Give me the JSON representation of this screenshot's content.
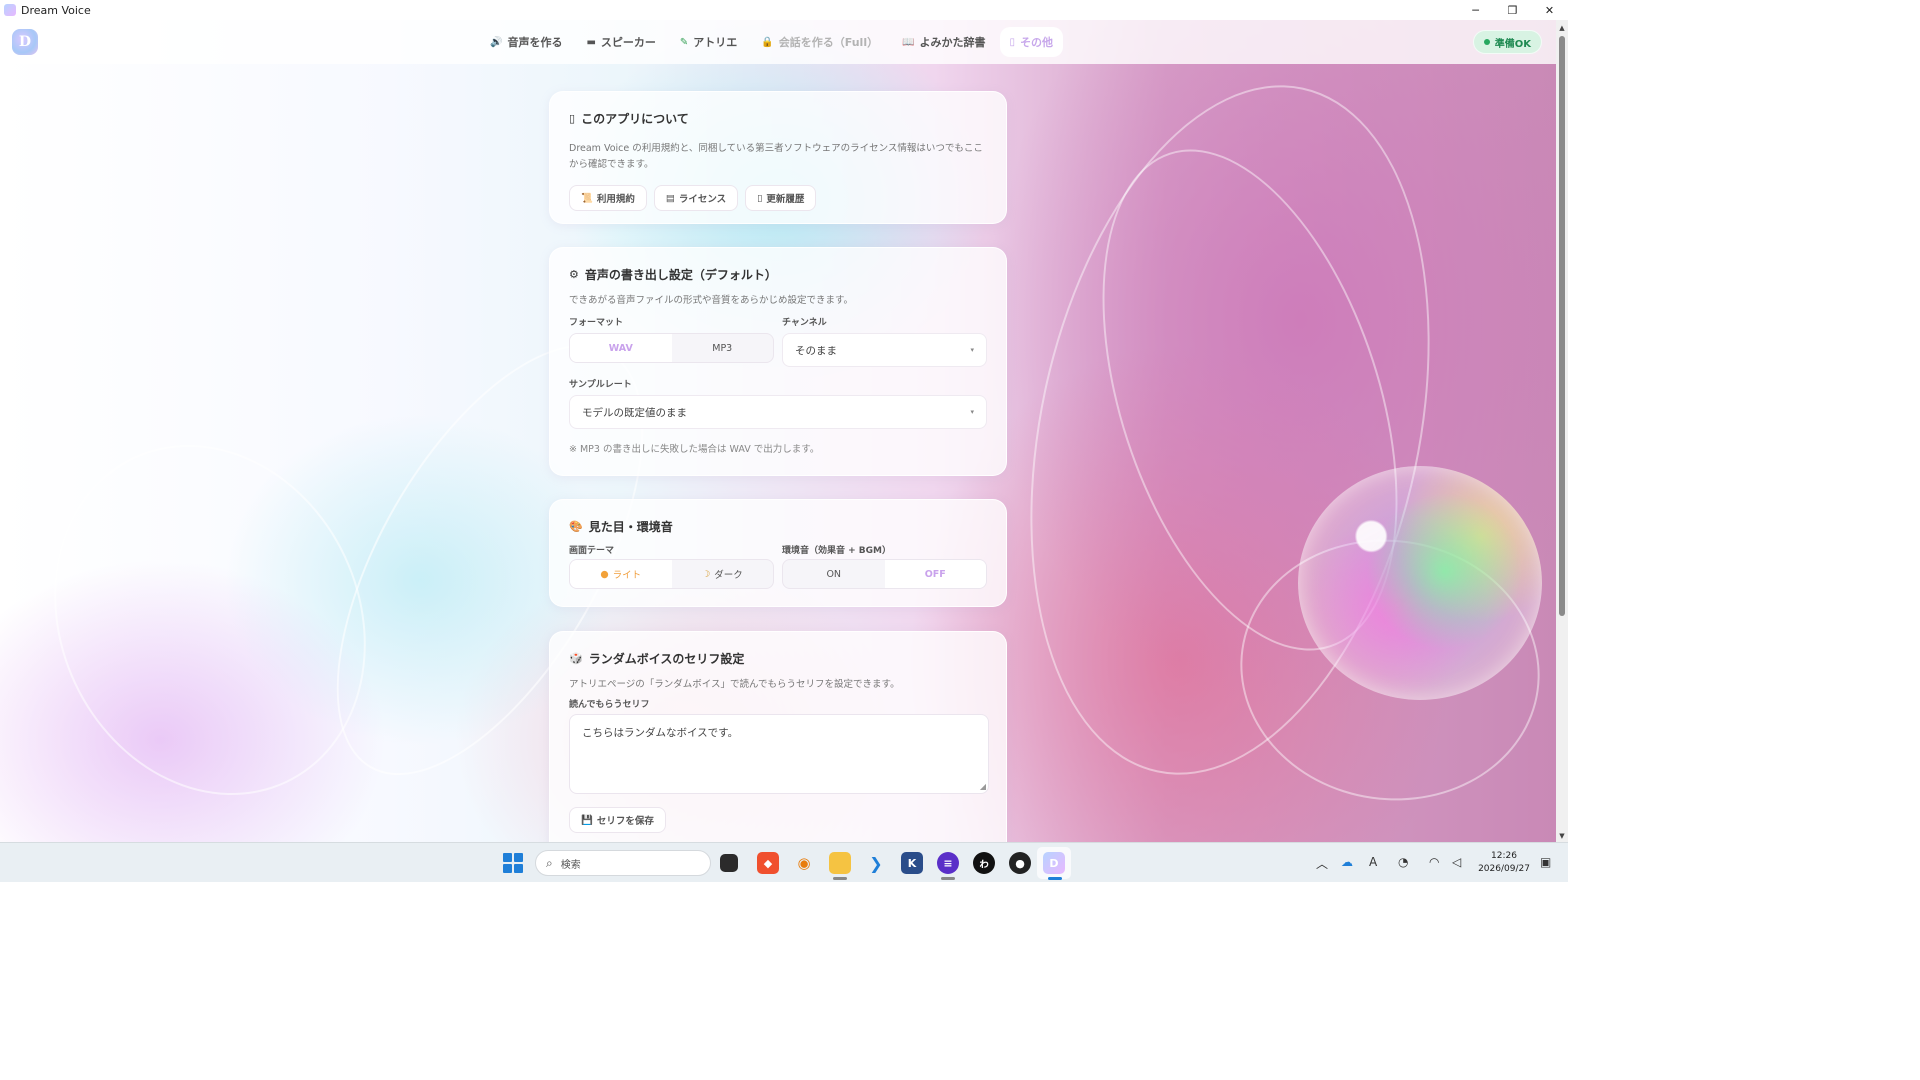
{
  "window": {
    "title": "Dream Voice",
    "minimize": "─",
    "restore": "❐",
    "close": "✕"
  },
  "nav": {
    "logo_glyph": "D",
    "tabs": [
      {
        "icon": "🔊",
        "label": "音声を作る",
        "state": "normal"
      },
      {
        "icon": "▬",
        "label": "スピーカー",
        "state": "normal"
      },
      {
        "icon": "✎",
        "label": "アトリエ",
        "state": "normal"
      },
      {
        "icon": "🔒",
        "label": "会話を作る（Full）",
        "state": "disabled"
      },
      {
        "icon": "📖",
        "label": "よみかた辞書",
        "state": "normal"
      },
      {
        "icon": "▯",
        "label": "その他",
        "state": "active"
      }
    ],
    "status": "準備OK"
  },
  "about": {
    "icon": "▯",
    "title": "このアプリについて",
    "desc": "Dream Voice の利用規約と、同梱している第三者ソフトウェアのライセンス情報はいつでもここから確認できます。",
    "buttons": [
      {
        "icon": "📜",
        "label": "利用規約"
      },
      {
        "icon": "▤",
        "label": "ライセンス"
      },
      {
        "icon": "▯",
        "label": "更新履歴"
      }
    ]
  },
  "export": {
    "icon": "⚙",
    "title": "音声の書き出し設定（デフォルト）",
    "desc": "できあがる音声ファイルの形式や音質をあらかじめ設定できます。",
    "format_label": "フォーマット",
    "format_options": [
      "WAV",
      "MP3"
    ],
    "format_selected": "WAV",
    "channel_label": "チャンネル",
    "channel_value": "そのまま",
    "samplerate_label": "サンプルレート",
    "samplerate_value": "モデルの既定値のまま",
    "note": "※ MP3 の書き出しに失敗した場合は WAV で出力します。",
    "caret": "▾"
  },
  "appearance": {
    "icon": "🎨",
    "title": "見た目・環境音",
    "theme_label": "画面テーマ",
    "theme_options": [
      {
        "icon": "●",
        "label": "ライト"
      },
      {
        "icon": "☽",
        "label": "ダーク"
      }
    ],
    "theme_selected": "ライト",
    "ambient_label": "環境音（効果音 + BGM）",
    "ambient_options": [
      "ON",
      "OFF"
    ],
    "ambient_selected": "OFF"
  },
  "random_voice": {
    "icon": "🎲",
    "title": "ランダムボイスのセリフ設定",
    "desc": "アトリエページの「ランダムボイス」で読んでもらうセリフを設定できます。",
    "field_label": "読んでもらうセリフ",
    "text": "こちらはランダムなボイスです。",
    "save_icon": "💾",
    "save_label": "セリフを保存"
  },
  "taskbar": {
    "search_placeholder": "検索",
    "clock_time": "12:26",
    "clock_date": "2026/09/27",
    "ime": "A"
  },
  "colors": {
    "accent": "#c7a7eb",
    "status_green": "#1f8a52",
    "taskbar_blue": "#1f7fd8"
  }
}
